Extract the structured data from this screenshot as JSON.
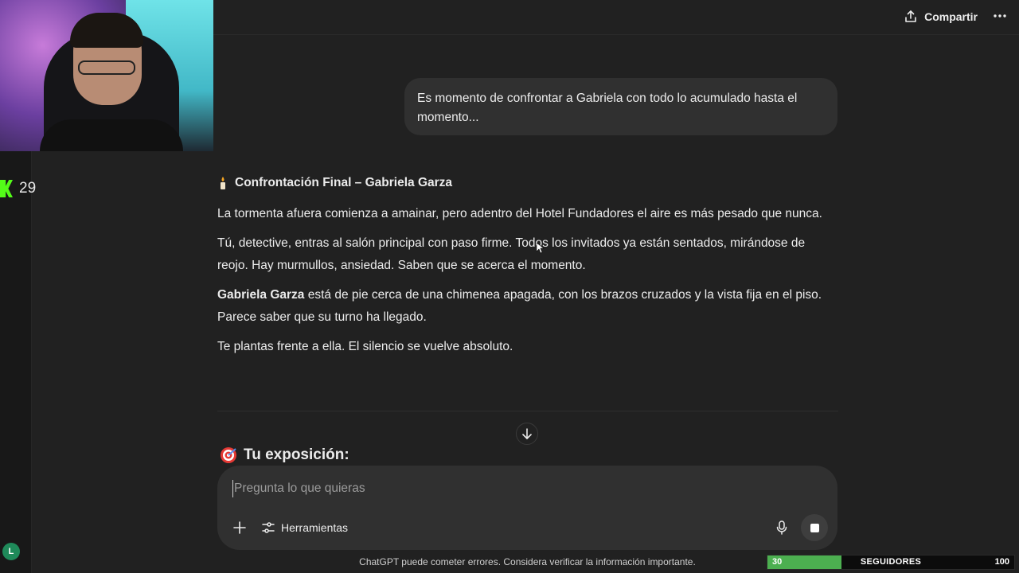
{
  "header": {
    "share_label": "Compartir",
    "more_label": "···"
  },
  "stream": {
    "kick_viewers": "29",
    "user_initial": "L",
    "followers": {
      "current": "30",
      "label": "SEGUIDORES",
      "goal": "100",
      "progress_fraction": 0.3,
      "bar_color": "#4caf50"
    }
  },
  "conversation": {
    "user_message": "Es momento de confrontar a Gabriela con todo lo acumulado hasta el momento...",
    "assistant": {
      "title_icon": "candle-icon",
      "title": "Confrontación Final – Gabriela Garza",
      "paragraph_1": "La tormenta afuera comienza a amainar, pero adentro del Hotel Fundadores el aire es más pesado que nunca.",
      "paragraph_2": "Tú, detective, entras al salón principal con paso firme. Todos los invitados ya están sentados, mirándose de reojo. Hay murmullos, ansiedad. Saben que se acerca el momento.",
      "paragraph_3_bold": "Gabriela Garza",
      "paragraph_3_rest": " está de pie cerca de una chimenea apagada, con los brazos cruzados y la vista fija en el piso. Parece saber que su turno ha llegado.",
      "paragraph_4": "Te plantas frente a ella. El silencio se vuelve absoluto.",
      "section_icon": "target-icon",
      "section_heading": "Tu exposición:"
    }
  },
  "composer": {
    "placeholder": "Pregunta lo que quieras",
    "tools_label": "Herramientas"
  },
  "footer": {
    "disclaimer": "ChatGPT puede cometer errores. Considera verificar la información importante."
  },
  "colors": {
    "background": "#212121",
    "bubble": "#303030",
    "kick_green": "#53fc18"
  }
}
